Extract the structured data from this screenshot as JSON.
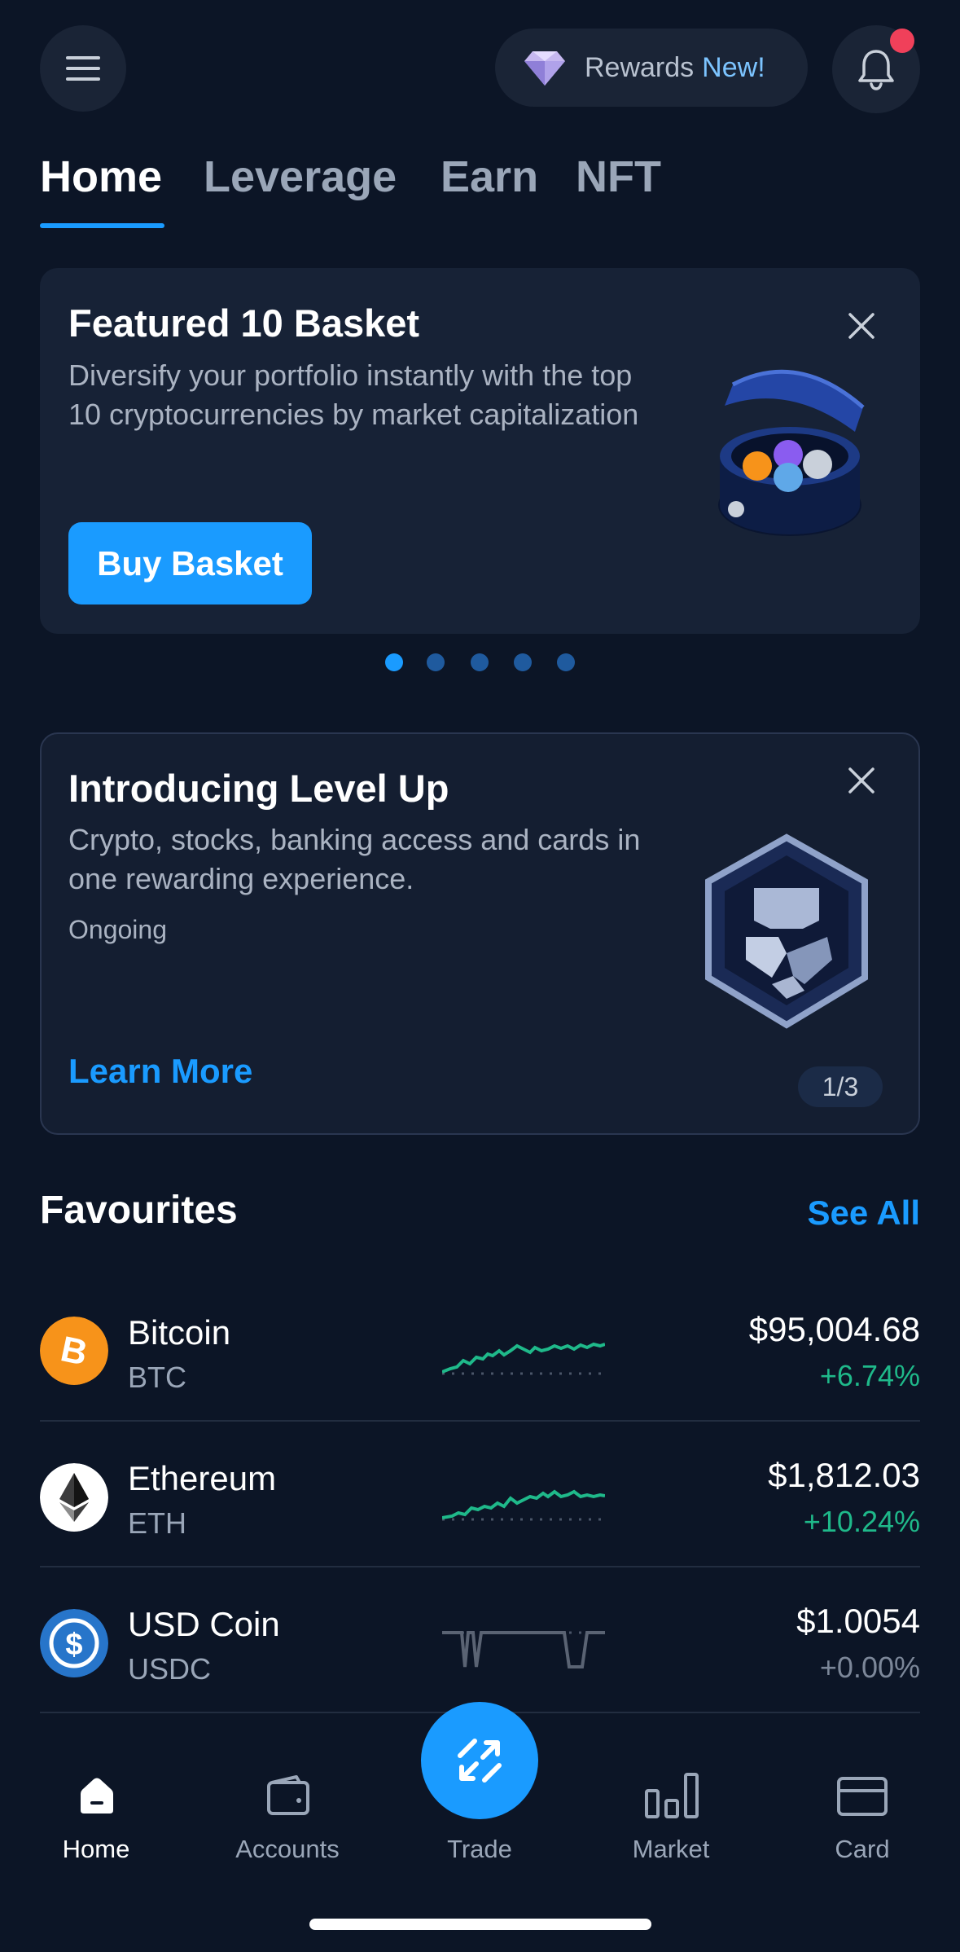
{
  "header": {
    "rewards_label": "Rewards",
    "rewards_badge": "New!",
    "notification_dot": true
  },
  "tabs": [
    {
      "label": "Home",
      "active": true
    },
    {
      "label": "Leverage",
      "active": false
    },
    {
      "label": "Earn",
      "active": false
    },
    {
      "label": "NFT",
      "active": false
    }
  ],
  "featured_card": {
    "title": "Featured 10 Basket",
    "description": "Diversify your portfolio instantly with the top 10 cryptocurrencies by market capitalization",
    "button_label": "Buy Basket",
    "carousel_count": 5,
    "carousel_active": 1
  },
  "levelup_card": {
    "title": "Introducing Level Up",
    "description": "Crypto, stocks, banking access and cards in one rewarding experience.",
    "status": "Ongoing",
    "link_label": "Learn More",
    "page_indicator": "1/3"
  },
  "favourites": {
    "title": "Favourites",
    "see_all_label": "See All",
    "items": [
      {
        "name": "Bitcoin",
        "symbol": "BTC",
        "price": "$95,004.68",
        "change": "+6.74%",
        "trend": "up",
        "icon": "bitcoin-icon",
        "icon_color": "#f7931a"
      },
      {
        "name": "Ethereum",
        "symbol": "ETH",
        "price": "$1,812.03",
        "change": "+10.24%",
        "trend": "up",
        "icon": "ethereum-icon",
        "icon_color": "#ffffff"
      },
      {
        "name": "USD Coin",
        "symbol": "USDC",
        "price": "$1.0054",
        "change": "+0.00%",
        "trend": "flat",
        "icon": "usdc-icon",
        "icon_color": "#2775ca"
      }
    ]
  },
  "bottom_nav": [
    {
      "label": "Home",
      "icon": "home-icon",
      "active": true
    },
    {
      "label": "Accounts",
      "icon": "wallet-icon",
      "active": false
    },
    {
      "label": "Trade",
      "icon": "swap-arrows-icon",
      "active": false
    },
    {
      "label": "Market",
      "icon": "bar-chart-icon",
      "active": false
    },
    {
      "label": "Card",
      "icon": "card-icon",
      "active": false
    }
  ],
  "colors": {
    "background": "#0c1526",
    "card": "#172236",
    "accent": "#1a9bff",
    "positive": "#1fb98a",
    "neutral": "#7c8799",
    "notification": "#f0405a"
  }
}
